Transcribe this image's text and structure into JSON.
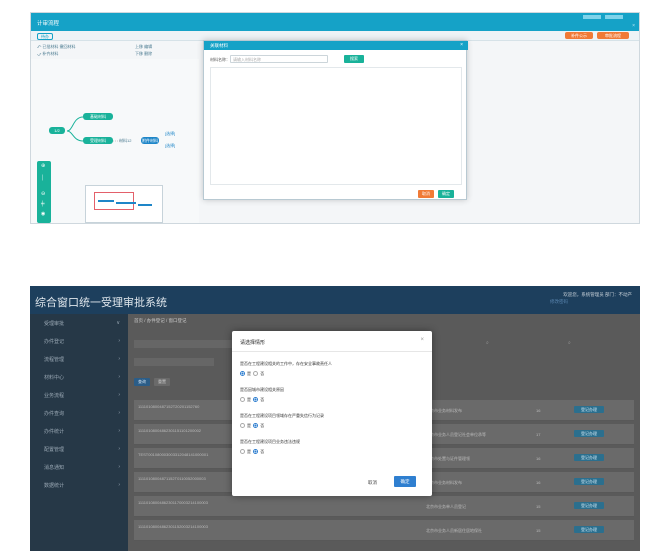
{
  "top_app": {
    "title": "计审流程",
    "tab_label": "待办",
    "button_1": "补件公示",
    "button_2": "审批流程",
    "toolbar_left": [
      "已批材料",
      "撤回材料",
      "补齐材料"
    ],
    "toolbar_mid": [
      "上移",
      "下移",
      "编辑",
      "删除"
    ],
    "nodes": [
      "基础材料",
      "受理材料",
      "附件材料"
    ],
    "badge": "1/2",
    "sub_label": "材料12",
    "link_label": "[选择]"
  },
  "modal_material": {
    "title": "关联材料",
    "label": "材料名称：",
    "placeholder": "请输入材料名称",
    "search_label": "搜索",
    "cancel_label": "取消",
    "confirm_label": "确定"
  },
  "bottom_app": {
    "title": "综合窗口统一受理审批系统",
    "user_info": "欢迎您，系统管理员  部门：不动产",
    "user_link": "修改密码",
    "sidebar": [
      {
        "label": "受理审批"
      },
      {
        "label": "办件登记"
      },
      {
        "label": "流程管理"
      },
      {
        "label": "材料中心"
      },
      {
        "label": "业务流程"
      },
      {
        "label": "办件查询"
      },
      {
        "label": "办件统计"
      },
      {
        "label": "配置管理"
      },
      {
        "label": "消息通知"
      },
      {
        "label": "数据统计"
      }
    ],
    "breadcrumb": "首页  /  办件登记  /  窗口登记",
    "query_label": "查询",
    "reset_label": "重置",
    "rows": [
      {
        "id": "1111010800487152T20201152760",
        "org": "北京市业务材料发布",
        "count": "16",
        "action": "登记办理"
      },
      {
        "id": "11110108004862301151101200002",
        "org": "北京市业务人员登记社会单位承等",
        "count": "17",
        "action": "登记办理"
      },
      {
        "id": "TEST001080003003312048141000001",
        "org": "北京市处置与证件管理领",
        "count": "16",
        "action": "登记办理"
      },
      {
        "id": "11110108004871152T0110052000003",
        "org": "北京市业务材料发布",
        "count": "16",
        "action": "登记办理"
      },
      {
        "id": "11110108004862301170003214100003",
        "org": "北京市业务单人员登记",
        "count": "15",
        "action": "登记办理"
      },
      {
        "id": "11110108004862301152003214100003",
        "org": "北京市业务人员新居住居地保社",
        "count": "15",
        "action": "登记办理"
      }
    ]
  },
  "modal_scenario": {
    "title": "请选择情形",
    "questions": [
      {
        "q": "是否在工程建设相关的工作中，存在安全事故责任人",
        "yes": "是",
        "no": "否",
        "selected": "yes"
      },
      {
        "q": "是否因城市建设相关原因",
        "yes": "是",
        "no": "否",
        "selected": "no"
      },
      {
        "q": "是否在工程建设项目领域存在严重失信行为记录",
        "yes": "是",
        "no": "否",
        "selected": "no"
      },
      {
        "q": "是否在工程建设项目业务违法违规",
        "yes": "是",
        "no": "否",
        "selected": "no"
      }
    ],
    "cancel_label": "取消",
    "confirm_label": "确定"
  }
}
